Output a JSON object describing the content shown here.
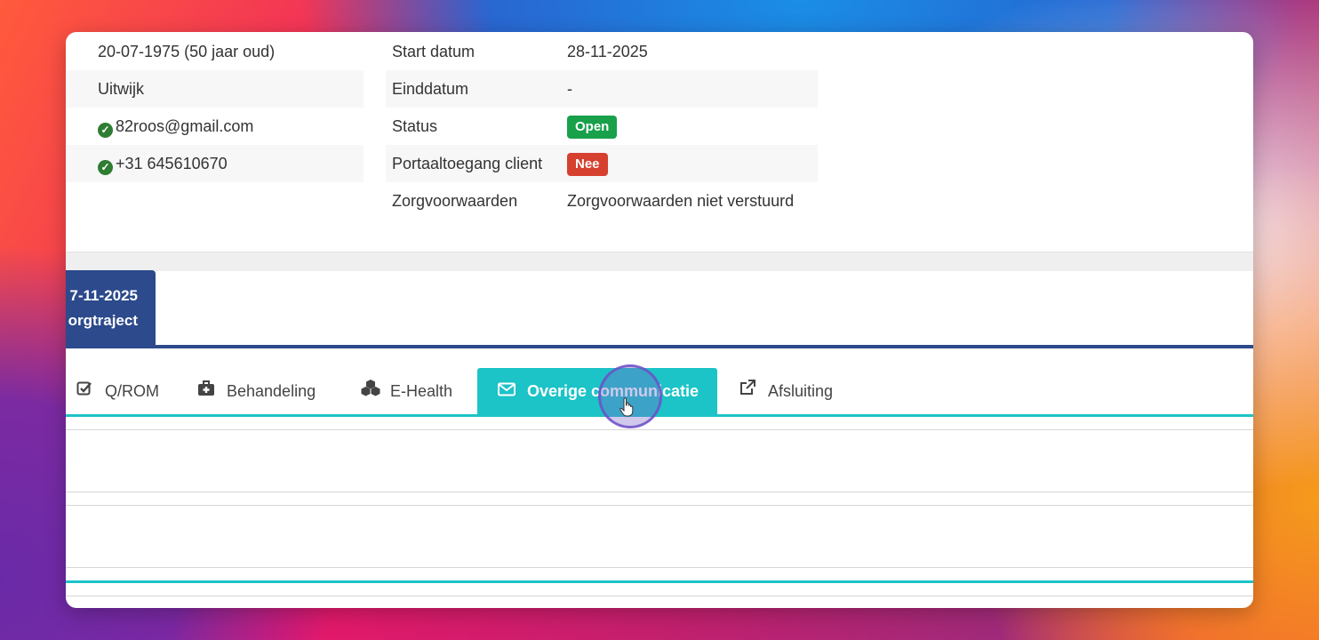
{
  "client": {
    "birth": "20-07-1975 (50 jaar oud)",
    "city": "Uitwijk",
    "email": "82roos@gmail.com",
    "phone": "+31 645610670"
  },
  "trajectory_info": {
    "start_label": "Start datum",
    "start_value": "28-11-2025",
    "end_label": "Einddatum",
    "end_value": "-",
    "status_label": "Status",
    "status_value": "Open",
    "portal_label": "Portaaltoegang client",
    "portal_value": "Nee",
    "conditions_label": "Zorgvoorwaarden",
    "conditions_value": "Zorgvoorwaarden niet verstuurd"
  },
  "trajectory_tab": {
    "date": "7-11-2025",
    "label": "orgtraject"
  },
  "tabs": [
    {
      "label": "Q/ROM",
      "icon": "checkbox-icon"
    },
    {
      "label": "Behandeling",
      "icon": "medkit-icon"
    },
    {
      "label": "E-Health",
      "icon": "cubes-icon"
    },
    {
      "label": "Overige communicatie",
      "icon": "envelope-icon",
      "active": true
    },
    {
      "label": "Afsluiting",
      "icon": "external-link-icon"
    }
  ],
  "colors": {
    "accent_teal": "#1cc3c7",
    "trajectory_blue": "#2c4a8c",
    "status_green": "#18a04a",
    "status_red": "#d6402f"
  }
}
